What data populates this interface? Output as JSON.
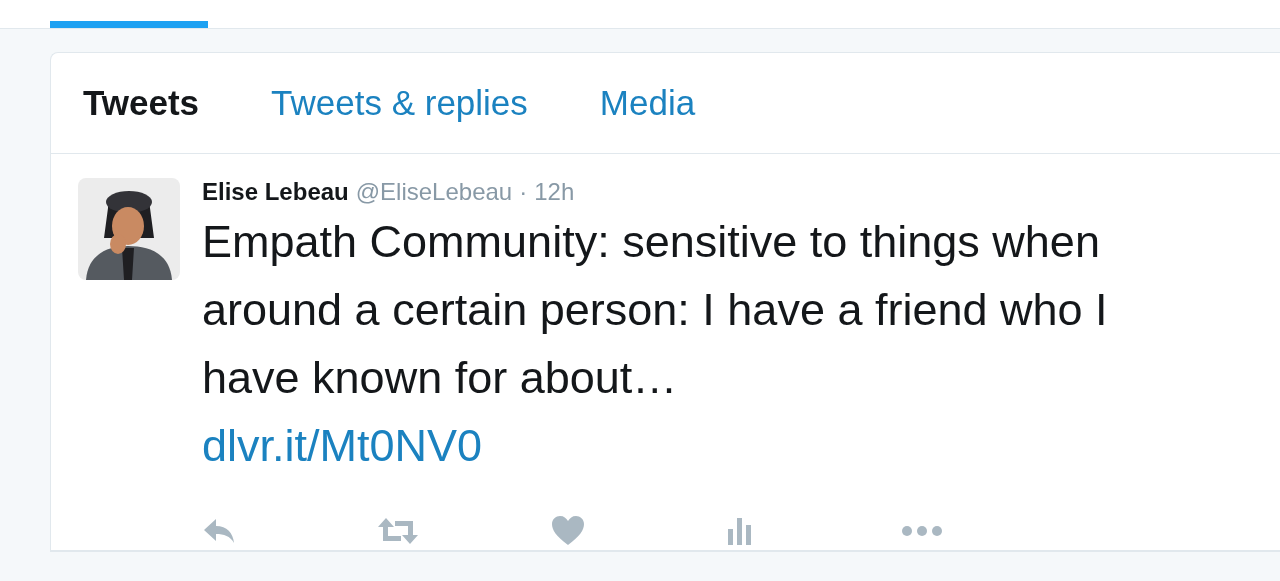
{
  "profile_tabs": [
    {
      "label": "Tweets",
      "selected": true
    },
    {
      "label": "Tweets & replies",
      "selected": false
    },
    {
      "label": "Media",
      "selected": false
    }
  ],
  "tweet": {
    "name": "Elise Lebeau",
    "handle": "@EliseLebeau",
    "separator": "·",
    "time": "12h",
    "text": "Empath Community: sensitive to things when around a certain person: I have a friend who I have known for about…",
    "link": "dlvr.it/Mt0NV0",
    "actions": [
      {
        "kind": "reply"
      },
      {
        "kind": "retweet"
      },
      {
        "kind": "like"
      },
      {
        "kind": "analytics"
      },
      {
        "kind": "more"
      }
    ]
  }
}
